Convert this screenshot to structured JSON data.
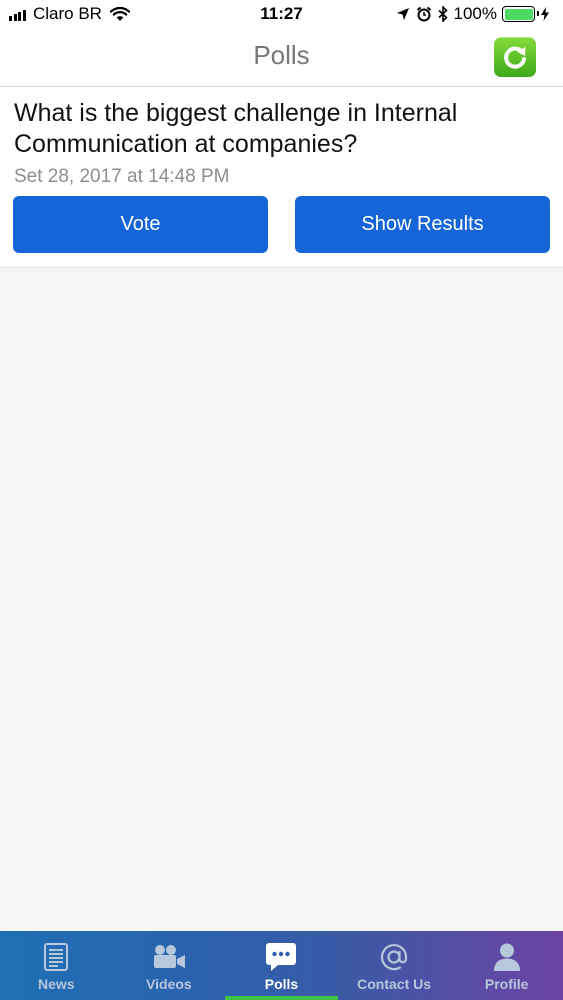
{
  "status_bar": {
    "carrier": "Claro BR",
    "time": "11:27",
    "battery_percent": "100%",
    "battery_level": 1.0
  },
  "nav": {
    "title": "Polls",
    "refresh_icon": "refresh-icon"
  },
  "poll": {
    "question": "What is the biggest challenge in Internal Communication at companies?",
    "date": "Set 28, 2017 at 14:48 PM",
    "vote_label": "Vote",
    "results_label": "Show Results"
  },
  "tabs": [
    {
      "label": "News",
      "icon": "news-icon",
      "active": false
    },
    {
      "label": "Videos",
      "icon": "video-camera-icon",
      "active": false
    },
    {
      "label": "Polls",
      "icon": "chat-bubble-icon",
      "active": true
    },
    {
      "label": "Contact Us",
      "icon": "at-sign-icon",
      "active": false
    },
    {
      "label": "Profile",
      "icon": "person-icon",
      "active": false
    }
  ],
  "colors": {
    "button_blue": "#1565d8",
    "active_tab_indicator": "#3ec243",
    "refresh_green": "#5cc22a"
  }
}
